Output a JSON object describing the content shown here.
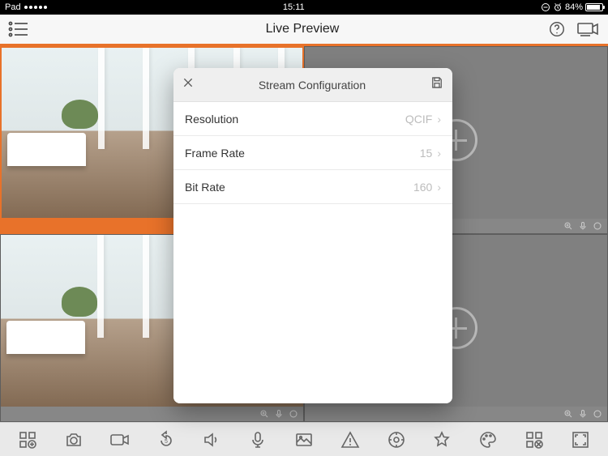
{
  "status": {
    "device": "Pad",
    "time": "15:11",
    "battery_pct": "84%"
  },
  "header": {
    "title": "Live Preview"
  },
  "modal": {
    "title": "Stream Configuration",
    "rows": [
      {
        "label": "Resolution",
        "value": "QCIF"
      },
      {
        "label": "Frame Rate",
        "value": "15"
      },
      {
        "label": "Bit Rate",
        "value": "160"
      }
    ]
  },
  "icons": {
    "menu": "list-menu",
    "help": "help-circle",
    "device": "device-camera",
    "toolbar": [
      "grid-add",
      "camera",
      "video",
      "rewind-5",
      "speaker",
      "mic",
      "image",
      "alert",
      "aperture",
      "star",
      "palette",
      "grid-remove",
      "fullscreen"
    ]
  },
  "colors": {
    "accent": "#e8722a"
  }
}
